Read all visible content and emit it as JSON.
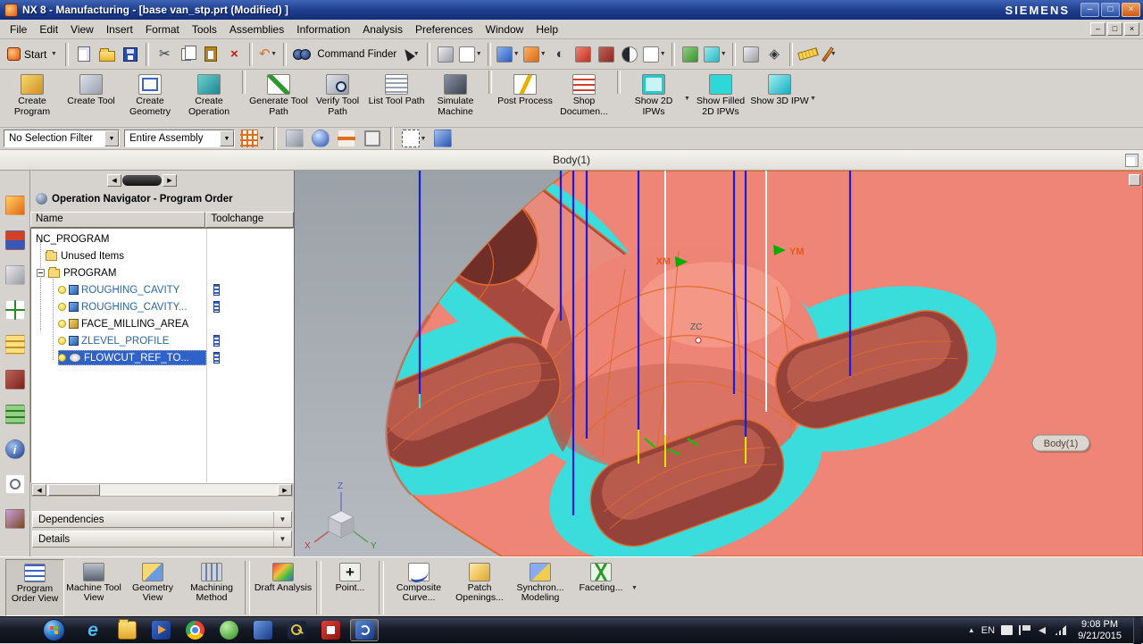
{
  "window": {
    "title": "NX 8 - Manufacturing - [base van_stp.prt (Modified) ]",
    "brand": "SIEMENS"
  },
  "menu": {
    "items": [
      "File",
      "Edit",
      "View",
      "Insert",
      "Format",
      "Tools",
      "Assemblies",
      "Information",
      "Analysis",
      "Preferences",
      "Window",
      "Help"
    ]
  },
  "icons": {
    "cut": "✂",
    "undo": "↶",
    "delete": "×",
    "dropdown": "▼",
    "left_arrow": "◀",
    "right_arrow": "▶",
    "minimize": "–",
    "maximize": "□",
    "close": "×",
    "ie": "e",
    "info": "i",
    "plus": "+",
    "chevron_down": "▼",
    "half_shade": "◐",
    "cube": "◧",
    "diamond": "◈",
    "lines": "▤"
  },
  "toolbar": {
    "start_label": "Start",
    "command_finder_label": "Command Finder"
  },
  "ribbon": {
    "buttons": [
      "Create Program",
      "Create Tool",
      "Create Geometry",
      "Create Operation",
      "Generate Tool Path",
      "Verify Tool Path",
      "List Tool Path",
      "Simulate Machine",
      "Post Process",
      "Shop Documen...",
      "Show 2D IPWs",
      "Show Filled 2D IPWs",
      "Show 3D IPW"
    ]
  },
  "selection_bar": {
    "filter_value": "No Selection Filter",
    "scope_value": "Entire Assembly"
  },
  "prompt_bar": {
    "message": "Body(1)"
  },
  "navigator": {
    "title": "Operation Navigator - Program Order",
    "columns": {
      "name": "Name",
      "toolchange": "Toolchange"
    },
    "rows": [
      {
        "label": "NC_PROGRAM",
        "toolchange": false,
        "selected": false
      },
      {
        "label": "Unused Items",
        "toolchange": false,
        "selected": false
      },
      {
        "label": "PROGRAM",
        "toolchange": false,
        "selected": false
      },
      {
        "label": "ROUGHING_CAVITY",
        "toolchange": true,
        "selected": false
      },
      {
        "label": "ROUGHING_CAVITY...",
        "toolchange": true,
        "selected": false
      },
      {
        "label": "FACE_MILLING_AREA",
        "toolchange": false,
        "selected": false
      },
      {
        "label": "ZLEVEL_PROFILE",
        "toolchange": true,
        "selected": false
      },
      {
        "label": "FLOWCUT_REF_TO...",
        "toolchange": true,
        "selected": true
      }
    ],
    "sections": [
      "Dependencies",
      "Details"
    ]
  },
  "view_toolbar": {
    "buttons": [
      "Program Order View",
      "Machine Tool View",
      "Geometry View",
      "Machining Method",
      "Draft Analysis",
      "Point...",
      "Composite Curve...",
      "Patch Openings...",
      "Synchron... Modeling",
      "Faceting..."
    ]
  },
  "viewport": {
    "labels": {
      "xm": "XM",
      "ym": "YM",
      "zc": "ZC",
      "body_tag": "Body(1)",
      "axis_z": "Z",
      "axis_x": "X",
      "axis_y": "Y"
    }
  },
  "taskbar": {
    "language": "EN",
    "time": "9:08 PM",
    "date": "9/21/2015"
  },
  "colors": {
    "part_salmon": "#ef8577",
    "part_dark_red": "#95423a",
    "part_mid_red": "#b95b4c",
    "edge_orange": "#e06a2d",
    "highlight_cyan": "#3bdcdc",
    "selection_blue": "#2f62c8",
    "toolpath_blue": "#1a1ae0"
  }
}
